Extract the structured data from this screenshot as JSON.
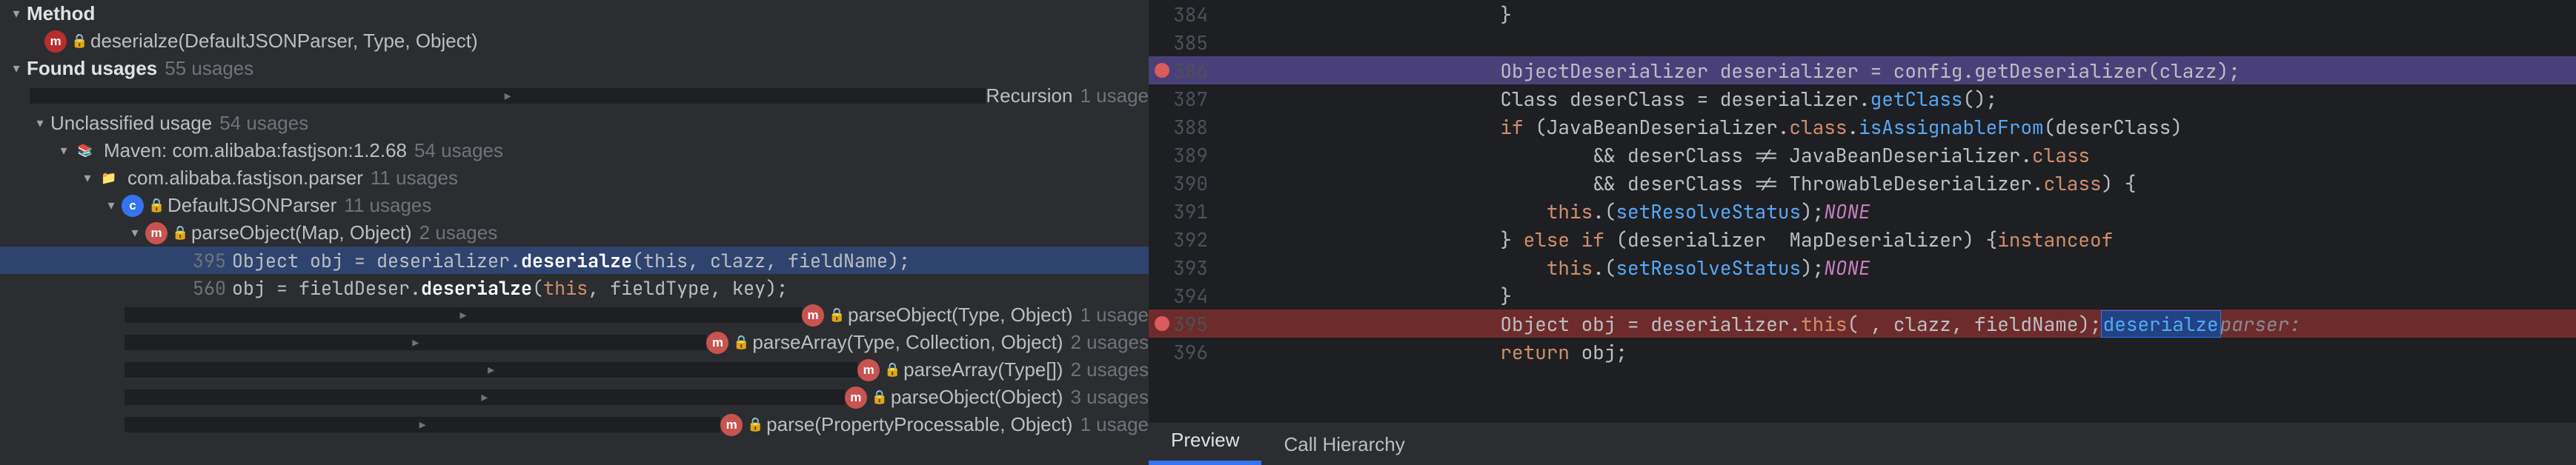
{
  "tree": {
    "method_header": "Method",
    "method_sig": "deserialze(DefaultJSONParser, Type, Object)",
    "found_usages": "Found usages",
    "found_usages_count": "55 usages",
    "recursion": "Recursion",
    "recursion_count": "1 usage",
    "unclassified": "Unclassified usage",
    "unclassified_count": "54 usages",
    "maven": "Maven: com.alibaba:fastjson:1.2.68",
    "maven_count": "54 usages",
    "pkg": "com.alibaba.fastjson.parser",
    "pkg_count": "11 usages",
    "class": "DefaultJSONParser",
    "class_count": "11 usages",
    "m_parseobj_map": "parseObject(Map, Object)",
    "m_parseobj_map_count": "2 usages",
    "usage395_ln": "395",
    "usage395_pre": "Object obj = deserializer.",
    "usage395_hl": "deserialze",
    "usage395_post": "(this, clazz, fieldName);",
    "usage560_ln": "560",
    "usage560_pre": "obj = fieldDeser.",
    "usage560_hl": "deserialze",
    "usage560_post": "(",
    "usage560_this": "this",
    "usage560_tail": ", fieldType, key);",
    "m_parseobj_type": "parseObject(Type, Object)",
    "m_parseobj_type_count": "1 usage",
    "m_parsearr_tc": "parseArray(Type, Collection, Object)",
    "m_parsearr_tc_count": "2 usages",
    "m_parsearr_ta": "parseArray(Type[])",
    "m_parsearr_ta_count": "2 usages",
    "m_parseobj_o": "parseObject(Object)",
    "m_parseobj_o_count": "3 usages",
    "m_parse_pp": "parse(PropertyProcessable, Object)",
    "m_parse_pp_count": "1 usage"
  },
  "code": {
    "lines": [
      {
        "n": "384",
        "t": "                        }"
      },
      {
        "n": "385",
        "t": ""
      },
      {
        "n": "386",
        "bp": true,
        "hl": "purple",
        "t": "                        ObjectDeserializer deserializer = config.getDeserializer(clazz);"
      },
      {
        "n": "387",
        "t": "                        Class deserClass = deserializer.",
        "fn": "getClass",
        "tail": "();"
      },
      {
        "n": "388",
        "t": "                        ",
        "kw": "if",
        "rest": " (JavaBeanDeserializer.",
        "cls": "class",
        "rest2": ".",
        "fn": "isAssignableFrom",
        "rest3": "(deserClass)"
      },
      {
        "n": "389",
        "t": "                                && deserClass != JavaBeanDeserializer.",
        "cls": "class"
      },
      {
        "n": "390",
        "t": "                                && deserClass != ThrowableDeserializer.",
        "cls": "class",
        "tail": ") {"
      },
      {
        "n": "391",
        "t": "                            ",
        "kw": "this",
        "rest": ".",
        "fn": "setResolveStatus",
        "rest2": "(",
        "con": "NONE",
        "rest3": ");"
      },
      {
        "n": "392",
        "t": "                        } ",
        "kw": "else if",
        "rest": " (deserializer ",
        "kw2": "instanceof",
        "rest2": " MapDeserializer) {"
      },
      {
        "n": "393",
        "t": "                            ",
        "kw": "this",
        "rest": ".",
        "fn": "setResolveStatus",
        "rest2": "(",
        "con": "NONE",
        "rest3": ");"
      },
      {
        "n": "394",
        "t": "                        }"
      },
      {
        "n": "395",
        "bp": true,
        "hl": "red",
        "t": "                        Object obj = deserializer.",
        "box": "deserialze",
        "rest": "( ",
        "hint": "parser: ",
        "kw": "this",
        "rest2": ", clazz, fieldName);"
      },
      {
        "n": "396",
        "t": "                        ",
        "kw": "return",
        "rest": " obj;"
      }
    ]
  },
  "tabs": {
    "preview": "Preview",
    "callh": "Call Hierarchy"
  }
}
